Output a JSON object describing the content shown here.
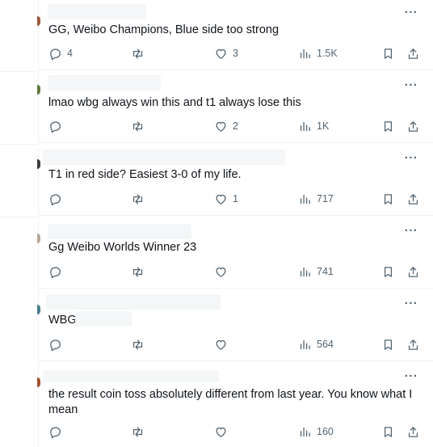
{
  "posts": [
    {
      "text": "GG, Weibo Champions, Blue side too strong",
      "replies": "4",
      "reposts": "",
      "likes": "3",
      "views": "1.5K"
    },
    {
      "text": "lmao wbg always win this and t1 always lose this",
      "replies": "",
      "reposts": "",
      "likes": "2",
      "views": "1K"
    },
    {
      "text": "T1 in red side? Easiest 3-0 of my life.",
      "replies": "",
      "reposts": "",
      "likes": "1",
      "views": "717"
    },
    {
      "text": "Gg Weibo Worlds Winner 23",
      "replies": "",
      "reposts": "",
      "likes": "",
      "views": "741"
    },
    {
      "text": "WBG",
      "replies": "",
      "reposts": "",
      "likes": "",
      "views": "564"
    },
    {
      "text": "the result coin toss absolutely different from last year. You know what I mean",
      "replies": "",
      "reposts": "",
      "likes": "",
      "views": "160"
    }
  ],
  "more_glyph": "···",
  "icons": {
    "reply": "reply-icon",
    "repost": "repost-icon",
    "like": "heart-icon",
    "views": "views-icon",
    "bookmark": "bookmark-icon",
    "share": "share-icon",
    "more": "more-icon"
  },
  "colors": {
    "text": "#0f1419",
    "muted": "#536471",
    "divider": "#eff3f4"
  }
}
